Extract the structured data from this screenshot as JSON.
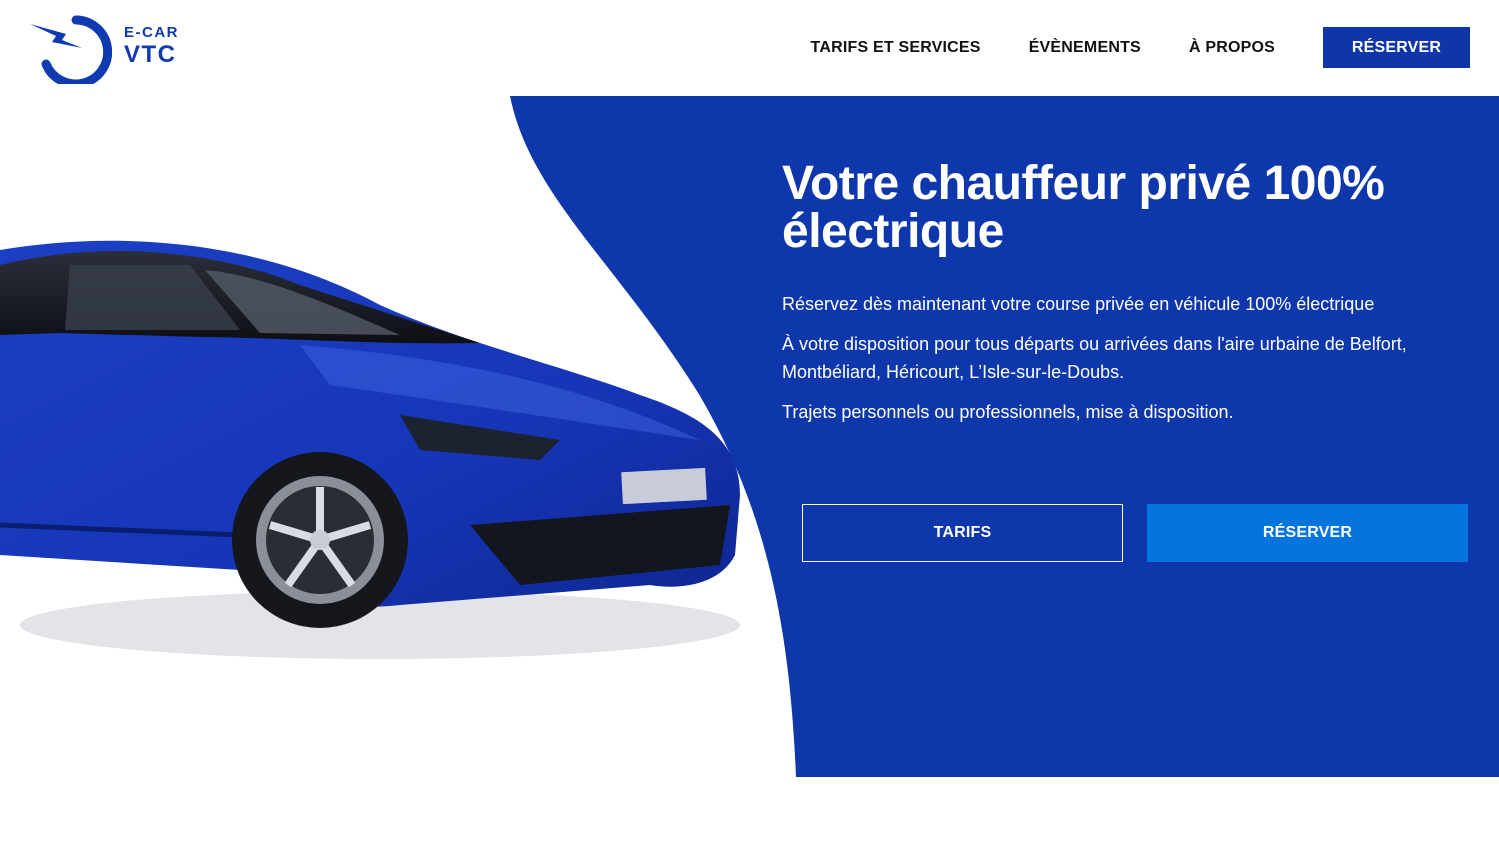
{
  "brand": {
    "line1": "E-CAR",
    "line2": "VTC"
  },
  "nav": {
    "links": [
      "TARIFS ET SERVICES",
      "ÉVÈNEMENTS",
      "À PROPOS"
    ],
    "cta": "RÉSERVER"
  },
  "hero": {
    "title": "Votre chauffeur privé 100% électrique",
    "paragraphs": [
      "Réservez dès maintenant votre course privée en véhicule 100% électrique",
      "À votre disposition pour tous départs ou arrivées dans l'aire urbaine de Belfort, Montbéliard, Héricourt, L’Isle-sur-le-Doubs.",
      "Trajets personnels ou professionnels, mise à disposition."
    ],
    "buttons": {
      "tarifs": "TARIFS",
      "reserver": "RÉSERVER"
    }
  },
  "colors": {
    "brand_blue": "#0f36a8",
    "accent_blue": "#0575dd",
    "hero_blue": "#0d37ab"
  },
  "icons": [
    "lightning-logo-icon"
  ]
}
